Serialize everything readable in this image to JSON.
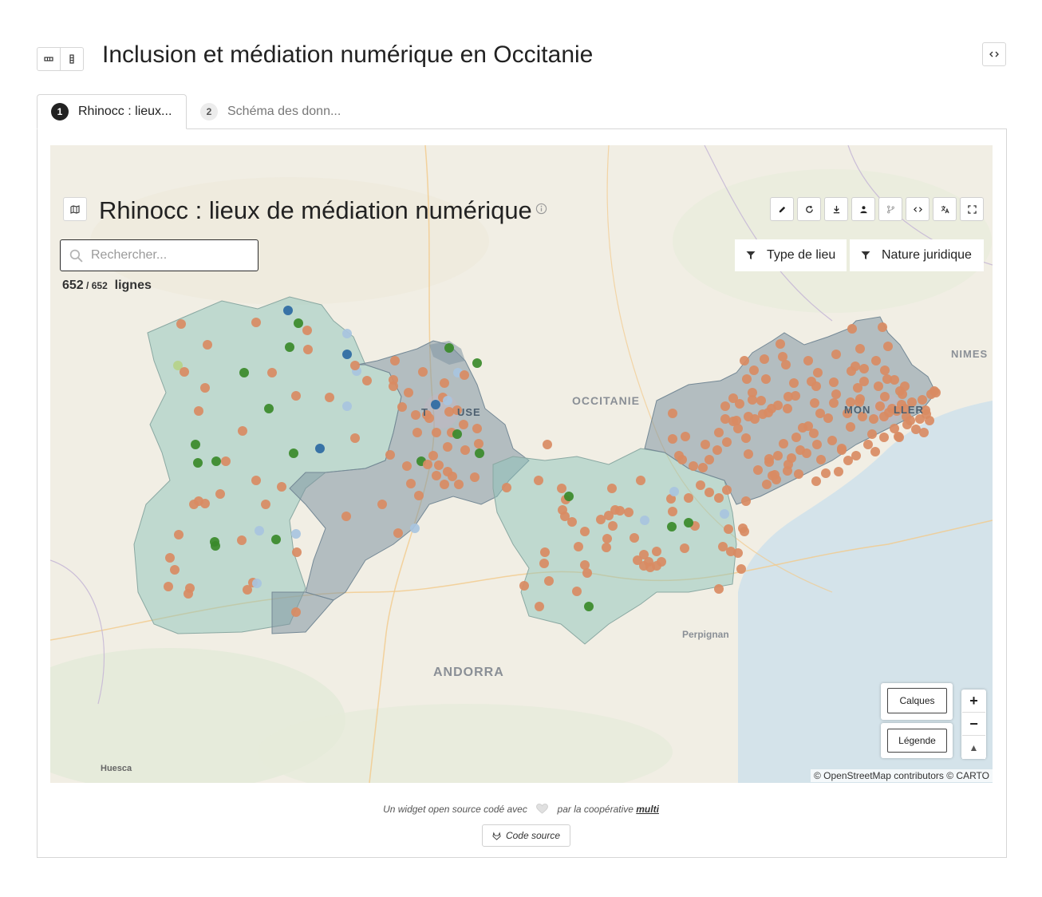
{
  "page": {
    "title": "Inclusion et médiation numérique en Occitanie",
    "left_icons": [
      "view-horizontal-icon",
      "view-vertical-icon"
    ],
    "right_icon": "code-icon"
  },
  "tabs": [
    {
      "num": "1",
      "label": "Rhinocc : lieux..."
    },
    {
      "num": "2",
      "label": "Schéma des donn..."
    }
  ],
  "widget": {
    "title": "Rhinocc : lieux de médiation numérique",
    "title_icon": "info-icon",
    "toolbar_icons": [
      "edit-icon",
      "refresh-icon",
      "download-icon",
      "user-icon",
      "branch-icon",
      "code-icon",
      "translate-icon",
      "fullscreen-icon"
    ],
    "search": {
      "placeholder": "Rechercher...",
      "value": ""
    },
    "count": {
      "shown": "652",
      "total": "652",
      "unit": "lignes"
    },
    "filters": [
      {
        "label": "Type de lieu",
        "icon": "filter-icon"
      },
      {
        "label": "Nature juridique",
        "icon": "filter-icon"
      }
    ]
  },
  "map": {
    "labels": {
      "occitanie": "OCCITANIE",
      "toulouse_a": "T",
      "toulouse_b": "USE",
      "montpellier_a": "MON",
      "montpellier_b": "LLER",
      "nimes": "NIMES",
      "perpignan": "Perpignan",
      "andorra": "ANDORRA",
      "huesca": "Huesca"
    },
    "controls": {
      "layers": "Calques",
      "legend": "Légende",
      "zoom_in": "+",
      "zoom_out": "−",
      "reset": "▲"
    },
    "attribution": "© OpenStreetMap contributors © CARTO",
    "colors": {
      "point_main": "#d98b63",
      "point_green": "#3a8a2a",
      "point_blue": "#2d6aa3",
      "point_light": "#a8c4e0",
      "region_teal": "#8ec3b9",
      "region_slate": "#7f95a3",
      "sea": "#d4e3ea"
    },
    "point_categories": [
      "orange",
      "green",
      "blue",
      "light-blue"
    ]
  },
  "footer": {
    "text_before": "Un widget open source codé avec",
    "text_after": "par la coopérative",
    "link": "multi",
    "source_button": "Code source"
  }
}
